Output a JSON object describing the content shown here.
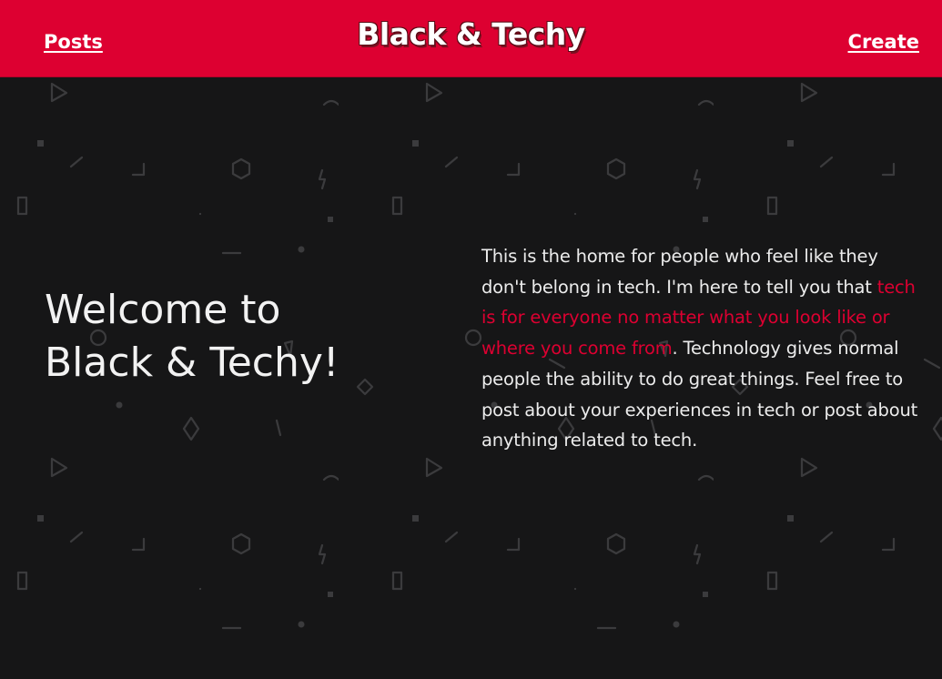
{
  "colors": {
    "accent": "#dd0031",
    "background": "#161617",
    "text": "#ececec"
  },
  "header": {
    "posts_label": "Posts",
    "brand": "Black & Techy",
    "create_label": "Create"
  },
  "hero": {
    "title_line1": "Welcome to",
    "title_line2": "Black & Techy!",
    "intro_before": "This is the home for people who feel like they don't belong in tech. I'm here to tell you that ",
    "intro_highlight": "tech is for everyone no matter what you look like or where you come from",
    "intro_after": ". Technology gives normal people the ability to do great things. Feel free to post about your experiences in tech or post about anything related to tech."
  }
}
